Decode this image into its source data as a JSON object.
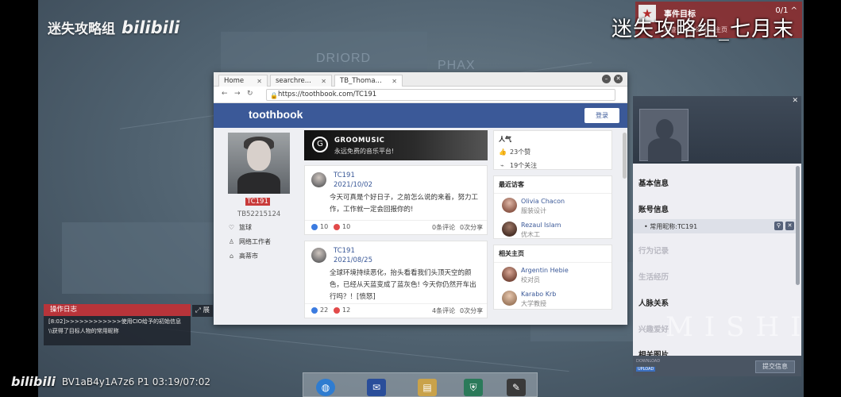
{
  "watermark": {
    "channel": "迷失攻略组",
    "bili": "bilibili",
    "corner_title": "迷失攻略组_七月末",
    "video_info": "BV1aB4y1A7z6 P1 03:19/07:02",
    "studio": "MISHI"
  },
  "objective": {
    "title": "事件目标",
    "count": "0/1",
    "subtitle": "调查通缉者的账号主页"
  },
  "map": {
    "labels": [
      "DRIORD",
      "PHAX"
    ]
  },
  "browser": {
    "tabs": [
      "Home",
      "searchre...",
      "TB_Thoma..."
    ],
    "url": "https://toothbook.com/TC191"
  },
  "site": {
    "logo": "toothbook",
    "login": "登录",
    "profile": {
      "name": "TC191",
      "id": "TB52215124",
      "attrs": [
        {
          "icon": "heart-icon",
          "label": "篮球"
        },
        {
          "icon": "badge-icon",
          "label": "网络工作者"
        },
        {
          "icon": "home-icon",
          "label": "高蒂市"
        }
      ]
    },
    "banner": {
      "title": "GROOMUSIC",
      "subtitle": "永远免费的音乐平台!"
    },
    "posts": [
      {
        "author": "TC191",
        "date": "2021/10/02",
        "text": "今天可真是个好日子，之前怎么说的来着，努力工作，工作就一定会回报你的!",
        "likes": "10",
        "dislikes": "10",
        "comments": "0条评论",
        "shares": "0次分享"
      },
      {
        "author": "TC191",
        "date": "2021/08/25",
        "text": "全球环境持续恶化，抬头看看我们头顶天空的颜色，已经从天蓝变成了蓝灰色! 今天你仍然开车出行吗？！[愤怒]",
        "likes": "22",
        "dislikes": "12",
        "comments": "4条评论",
        "shares": "0次分享"
      }
    ],
    "popularity": {
      "title": "人气",
      "likes": "23个赞",
      "follows": "19个关注"
    },
    "visitors": {
      "title": "最近访客",
      "items": [
        {
          "name": "Olivia Chacon",
          "role": "服装设计"
        },
        {
          "name": "Rezaul Islam",
          "role": "优木工"
        }
      ]
    },
    "related": {
      "title": "相关主页",
      "items": [
        {
          "name": "Argentin Hebie",
          "role": "校对员"
        },
        {
          "name": "Karabo Krb",
          "role": "大学教授"
        }
      ]
    }
  },
  "profile_panel": {
    "photo_label": "目标人物",
    "sections": {
      "basic": "基本信息",
      "account": "账号信息",
      "nickname": "常用昵称:TC191",
      "behavior": "行为记录",
      "life": "生活经历",
      "relations": "人脉关系",
      "family": "兴趣爱好",
      "photos": "相关图片"
    },
    "submit": "提交信息",
    "mini_caption": "DOWNLOAD",
    "mini_tag": "UPLOAD"
  },
  "log": {
    "title": "操作日志",
    "expand": "展",
    "lines": [
      "[8:02]>>>>>>>>>>>>使用CIO给予的初始信息",
      "\\\\获得了目标人物的常用昵称"
    ]
  },
  "colors": {
    "brand": "#3b5998",
    "accent_red": "#b8343a"
  }
}
